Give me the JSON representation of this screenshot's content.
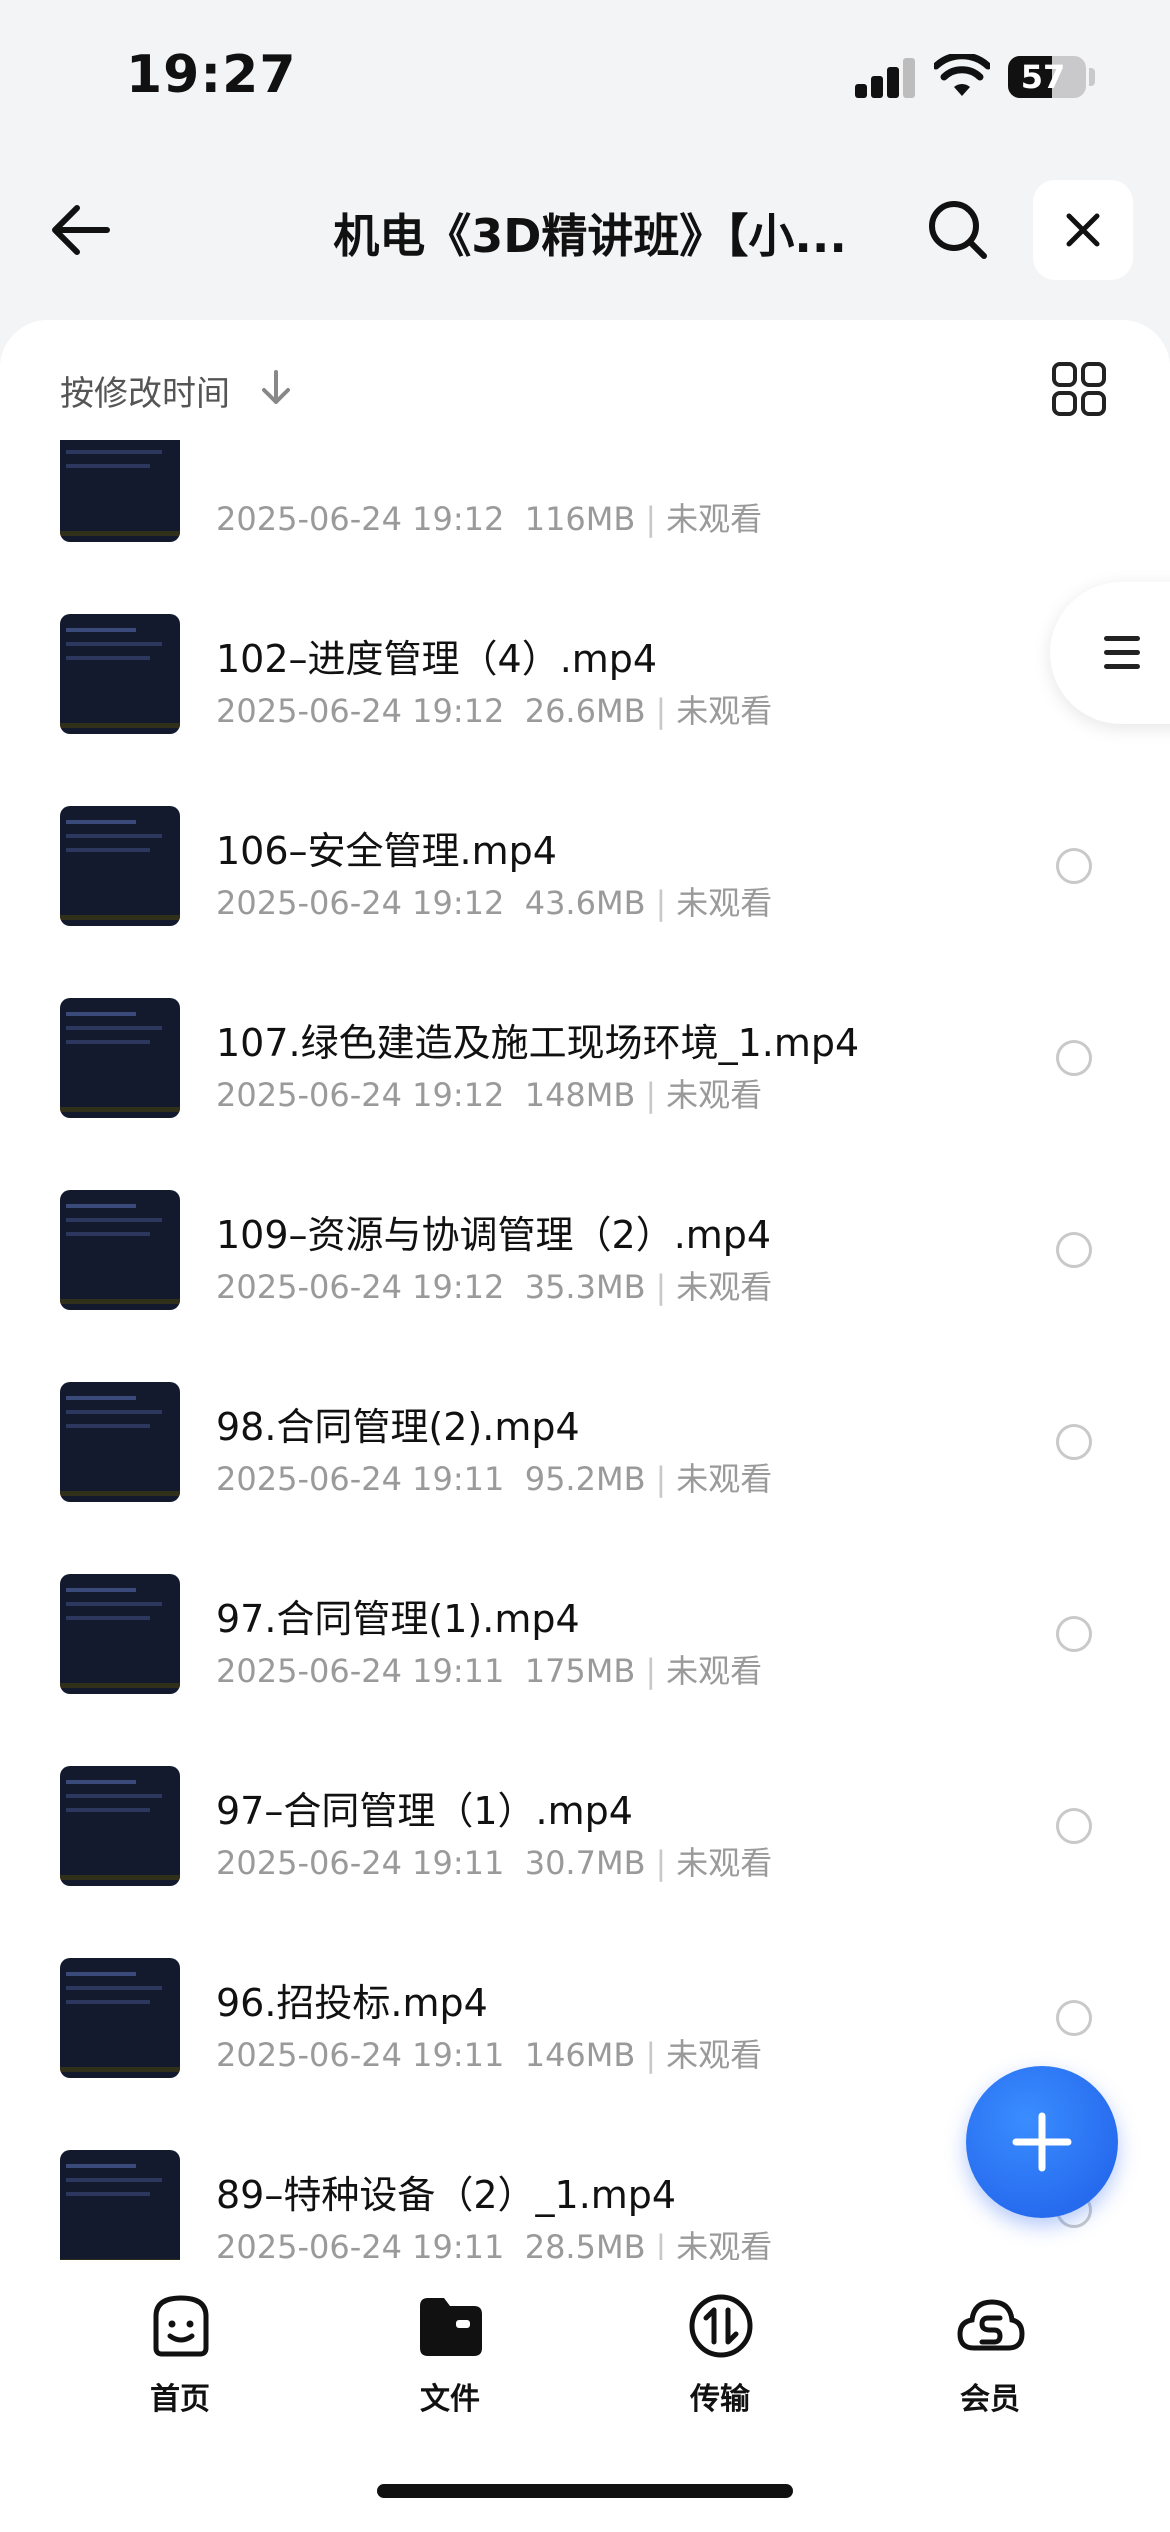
{
  "status_bar": {
    "time": "19:27",
    "battery": "57",
    "battery_level": 0.57
  },
  "header": {
    "title": "机电《3D精讲班》【小...",
    "back_icon": "arrow-left-icon",
    "search_icon": "search-icon",
    "close_icon": "close-icon"
  },
  "sort": {
    "label": "按修改时间",
    "direction_icon": "arrow-down-icon",
    "view_toggle_icon": "grid-view-icon"
  },
  "files": [
    {
      "name": "",
      "date": "2025-06-24 19:12",
      "size": "116MB",
      "status": "未观看"
    },
    {
      "name": "102–进度管理（4）.mp4",
      "date": "2025-06-24 19:12",
      "size": "26.6MB",
      "status": "未观看"
    },
    {
      "name": "106–安全管理.mp4",
      "date": "2025-06-24 19:12",
      "size": "43.6MB",
      "status": "未观看"
    },
    {
      "name": "107.绿色建造及施工现场环境_1.mp4",
      "date": "2025-06-24 19:12",
      "size": "148MB",
      "status": "未观看"
    },
    {
      "name": "109–资源与协调管理（2）.mp4",
      "date": "2025-06-24 19:12",
      "size": "35.3MB",
      "status": "未观看"
    },
    {
      "name": "98.合同管理(2).mp4",
      "date": "2025-06-24 19:11",
      "size": "95.2MB",
      "status": "未观看"
    },
    {
      "name": "97.合同管理(1).mp4",
      "date": "2025-06-24 19:11",
      "size": "175MB",
      "status": "未观看"
    },
    {
      "name": "97–合同管理（1）.mp4",
      "date": "2025-06-24 19:11",
      "size": "30.7MB",
      "status": "未观看"
    },
    {
      "name": "96.招投标.mp4",
      "date": "2025-06-24 19:11",
      "size": "146MB",
      "status": "未观看"
    },
    {
      "name": "89–特种设备（2）_1.mp4",
      "date": "2025-06-24 19:11",
      "size": "28.5MB",
      "status": "未观看"
    }
  ],
  "side_tab_icon": "menu-icon",
  "fab_icon": "plus-icon",
  "tabbar": [
    {
      "label": "首页",
      "icon": "smiley-home-icon"
    },
    {
      "label": "文件",
      "icon": "folder-icon"
    },
    {
      "label": "传输",
      "icon": "transfer-icon"
    },
    {
      "label": "会员",
      "icon": "cloud-member-icon"
    }
  ],
  "colors": {
    "accent": "#1f5ee8",
    "background": "#f3f4f6",
    "meta_text": "#9a9a9a"
  }
}
